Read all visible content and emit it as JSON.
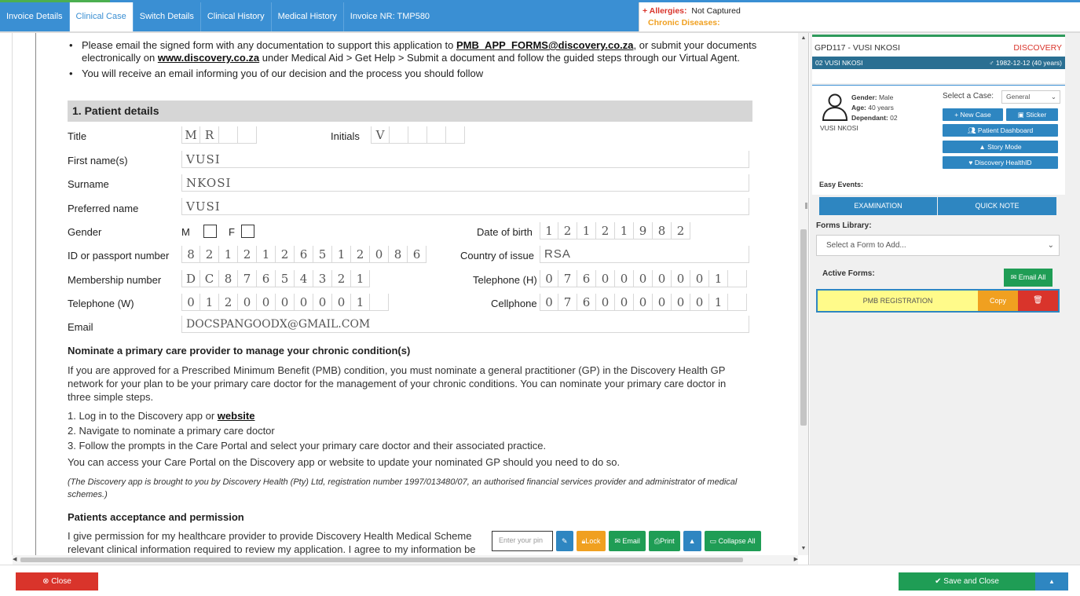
{
  "colors": {
    "primary": "#3a8fd3",
    "danger": "#d9342b",
    "warning": "#f0a020",
    "success": "#1f9d55"
  },
  "tabs": [
    {
      "label": "Invoice Details"
    },
    {
      "label": "Clinical Case"
    },
    {
      "label": "Switch Details"
    },
    {
      "label": "Clinical History"
    },
    {
      "label": "Medical History"
    },
    {
      "label": "Invoice NR: TMP580"
    }
  ],
  "alerts": {
    "allergies_label": "Allergies:",
    "allergies_value": "Not Captured",
    "chronic_label": "Chronic Diseases:"
  },
  "doc": {
    "bullet1": {
      "pre": "Please email the signed form with any documentation to support this application to ",
      "email": "PMB_APP_FORMS@discovery.co.za",
      "mid": ", or submit your documents electronically on ",
      "site": "www.discovery.co.za",
      "post": " under Medical Aid > Get Help > Submit a document and follow the guided steps through our Virtual Agent."
    },
    "bullet2": "You will receive an email informing you of our decision and the process you should follow",
    "section_title": "1.  Patient details",
    "labels": {
      "title": "Title",
      "initials": "Initials",
      "first_name": "First name(s)",
      "surname": "Surname",
      "preferred": "Preferred name",
      "gender": "Gender",
      "gender_m": "M",
      "gender_f": "F",
      "dob": "Date of birth",
      "id": "ID or passport number",
      "country": "Country of issue",
      "membership": "Membership number",
      "tel_h": "Telephone (H)",
      "tel_w": "Telephone (W)",
      "cell": "Cellphone",
      "email": "Email"
    },
    "values": {
      "title_cells": [
        "M",
        "R",
        "",
        ""
      ],
      "initials_cells": [
        "V",
        "",
        "",
        "",
        ""
      ],
      "first_name": "VUSI",
      "surname": "NKOSI",
      "preferred": "VUSI",
      "dob_cells": [
        "1",
        "2",
        "1",
        "2",
        "1",
        "9",
        "8",
        "2"
      ],
      "id_cells": [
        "8",
        "2",
        "1",
        "2",
        "1",
        "2",
        "6",
        "5",
        "1",
        "2",
        "0",
        "8",
        "6"
      ],
      "country": "RSA",
      "membership_cells": [
        "D",
        "C",
        "8",
        "7",
        "6",
        "5",
        "4",
        "3",
        "2",
        "1"
      ],
      "tel_h_cells": [
        "0",
        "7",
        "6",
        "0",
        "0",
        "0",
        "0",
        "0",
        "0",
        "1",
        ""
      ],
      "tel_w_cells": [
        "0",
        "1",
        "2",
        "0",
        "0",
        "0",
        "0",
        "0",
        "0",
        "1",
        ""
      ],
      "cell_cells": [
        "0",
        "7",
        "6",
        "0",
        "0",
        "0",
        "0",
        "0",
        "0",
        "1",
        ""
      ],
      "email": "DOCSPANGOODX@GMAIL.COM"
    },
    "nominate_title": "Nominate a primary care provider to manage your chronic condition(s)",
    "nominate_para": "If you are approved for a Prescribed Minimum Benefit (PMB) condition, you must nominate a general practitioner (GP) in the Discovery Health GP network for your plan to be your primary care doctor for the management of your chronic conditions. You can nominate your primary care doctor in three simple steps.",
    "step1_pre": "1.  Log in to the Discovery app or ",
    "step1_link": "website",
    "step2": "2.  Navigate to nominate a primary care doctor",
    "step3": "3.  Follow the prompts in the Care Portal and select your primary care doctor and their associated practice.",
    "portal_para": "You can access your Care Portal on the Discovery app or website to update your nominated GP should you need to do so.",
    "disclaimer": "(The Discovery app is brought to you by Discovery Health (Pty) Ltd, registration number 1997/013480/07, an authorised financial services provider and administrator of medical schemes.)",
    "acceptance_title": "Patients acceptance and permission",
    "acceptance_para1": "I give permission for my healthcare provider to provide Discovery Health Medical Scheme",
    "acceptance_para2": "relevant clinical information required to review my application. I agree to my information be"
  },
  "doc_toolbar": {
    "pin_placeholder": "Enter your pin",
    "lock": "Lock",
    "email": "Email",
    "print": "Print",
    "collapse": "Collapse All"
  },
  "patient": {
    "practice_code": "GPD117 - VUSI NKOSI",
    "insurer": "DISCOVERY",
    "bar_name": "02 VUSI NKOSI",
    "bar_dob": "1982-12-12 (40 years)",
    "gender_label": "Gender:",
    "gender": "Male",
    "age_label": "Age:",
    "age": "40 years",
    "dependant_label": "Dependant:",
    "dependant": "02",
    "name": "VUSI NKOSI"
  },
  "case": {
    "select_label": "Select a Case:",
    "selected": "General",
    "buttons": {
      "new_case": "New Case",
      "sticker": "Sticker",
      "dashboard": "Patient Dashboard",
      "story": "Story Mode",
      "healthid": "Discovery HealthID"
    }
  },
  "events": {
    "label": "Easy Events:",
    "examination": "EXAMINATION",
    "quick_note": "QUICK NOTE"
  },
  "forms": {
    "library_label": "Forms Library:",
    "select_placeholder": "Select a Form to Add...",
    "active_label": "Active Forms:",
    "email_all": "Email All",
    "active": [
      {
        "name": "PMB REGISTRATION",
        "copy": "Copy"
      }
    ]
  },
  "footer": {
    "close": "Close",
    "save": "Save and Close"
  }
}
